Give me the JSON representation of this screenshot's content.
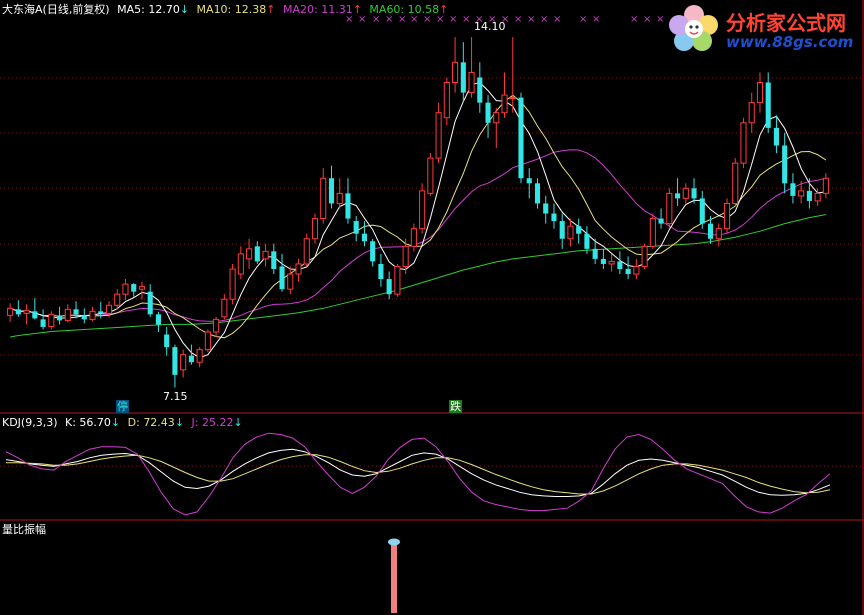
{
  "main_legend": {
    "stock": "大东海A(日线,前复权)",
    "ma5": "MA5: 12.70",
    "ma5_arrow": "↓",
    "ma10": "MA10: 12.38",
    "ma10_arrow": "↑",
    "ma20": "MA20: 11.31",
    "ma20_arrow": "↑",
    "ma60": "MA60: 10.58",
    "ma60_arrow": "↑"
  },
  "annotations": {
    "high_label": "14.10",
    "low_label": "7.15",
    "marker_stop": "停",
    "marker_fall": "跌"
  },
  "kdj_legend": {
    "name": "KDJ(9,3,3)",
    "k": "K: 56.70",
    "k_arrow": "↓",
    "d": "D: 72.43",
    "d_arrow": "↓",
    "j": "J: 25.22",
    "j_arrow": "↓"
  },
  "volume_panel": {
    "name": "量比振幅"
  },
  "logo": {
    "title": "分析家公式网",
    "url": "www.88gs.com"
  },
  "colors": {
    "background": "#000000",
    "up": "#ff3a3a",
    "down": "#34e5e5",
    "ma5": "#ffffff",
    "ma10": "#e8e07a",
    "ma20": "#d23cd2",
    "ma60": "#2fcc2f",
    "k": "#ffffff",
    "d": "#e8e07a",
    "j": "#d23cd2",
    "grid": "#8a1010",
    "volume_bar": "#f08080"
  },
  "chart_data": [
    {
      "type": "candlestick",
      "title": "大东海A(日线,前复权)",
      "ylim": [
        7.0,
        14.4
      ],
      "candles": [
        [
          8.58,
          8.82,
          8.45,
          8.72
        ],
        [
          8.7,
          8.88,
          8.55,
          8.6
        ],
        [
          8.62,
          8.8,
          8.4,
          8.68
        ],
        [
          8.66,
          8.92,
          8.5,
          8.52
        ],
        [
          8.5,
          8.7,
          8.3,
          8.35
        ],
        [
          8.36,
          8.66,
          8.3,
          8.6
        ],
        [
          8.58,
          8.75,
          8.4,
          8.48
        ],
        [
          8.48,
          8.8,
          8.44,
          8.7
        ],
        [
          8.7,
          8.86,
          8.52,
          8.6
        ],
        [
          8.58,
          8.72,
          8.42,
          8.5
        ],
        [
          8.5,
          8.75,
          8.46,
          8.66
        ],
        [
          8.66,
          8.85,
          8.52,
          8.62
        ],
        [
          8.62,
          8.86,
          8.54,
          8.78
        ],
        [
          8.78,
          9.1,
          8.7,
          9.0
        ],
        [
          9.0,
          9.3,
          8.88,
          9.2
        ],
        [
          9.2,
          9.22,
          8.95,
          9.05
        ],
        [
          9.1,
          9.25,
          8.9,
          9.15
        ],
        [
          9.05,
          9.2,
          8.55,
          8.6
        ],
        [
          8.6,
          8.65,
          8.25,
          8.4
        ],
        [
          8.2,
          8.35,
          7.78,
          7.95
        ],
        [
          7.95,
          8.0,
          7.15,
          7.4
        ],
        [
          7.5,
          7.9,
          7.35,
          7.8
        ],
        [
          7.78,
          8.0,
          7.6,
          7.65
        ],
        [
          7.65,
          7.95,
          7.55,
          7.9
        ],
        [
          7.9,
          8.3,
          7.85,
          8.25
        ],
        [
          8.25,
          8.55,
          8.15,
          8.5
        ],
        [
          8.55,
          9.0,
          8.5,
          8.9
        ],
        [
          8.9,
          9.6,
          8.8,
          9.5
        ],
        [
          9.4,
          9.95,
          9.3,
          9.8
        ],
        [
          9.7,
          10.1,
          9.5,
          9.9
        ],
        [
          9.95,
          10.05,
          9.6,
          9.65
        ],
        [
          9.7,
          10.0,
          9.55,
          9.85
        ],
        [
          9.85,
          10.0,
          9.4,
          9.5
        ],
        [
          9.55,
          9.8,
          9.05,
          9.1
        ],
        [
          9.1,
          9.55,
          9.0,
          9.4
        ],
        [
          9.4,
          9.7,
          9.25,
          9.6
        ],
        [
          9.6,
          10.2,
          9.55,
          10.1
        ],
        [
          10.1,
          10.6,
          10.0,
          10.5
        ],
        [
          10.5,
          11.5,
          10.4,
          11.3
        ],
        [
          11.3,
          11.55,
          10.7,
          10.8
        ],
        [
          10.8,
          11.3,
          10.7,
          11.0
        ],
        [
          11.0,
          11.3,
          10.4,
          10.5
        ],
        [
          10.45,
          10.55,
          10.05,
          10.2
        ],
        [
          10.2,
          10.45,
          9.95,
          10.05
        ],
        [
          10.05,
          10.1,
          9.55,
          9.65
        ],
        [
          9.6,
          9.8,
          9.15,
          9.3
        ],
        [
          9.3,
          9.45,
          8.9,
          9.0
        ],
        [
          9.0,
          9.6,
          8.95,
          9.55
        ],
        [
          9.55,
          10.1,
          9.4,
          9.95
        ],
        [
          9.95,
          10.4,
          9.85,
          10.3
        ],
        [
          10.3,
          11.2,
          10.2,
          11.05
        ],
        [
          11.0,
          11.8,
          10.95,
          11.7
        ],
        [
          11.7,
          12.8,
          11.6,
          12.6
        ],
        [
          12.5,
          13.3,
          12.35,
          13.2
        ],
        [
          13.2,
          14.1,
          13.0,
          13.6
        ],
        [
          13.6,
          14.0,
          12.8,
          13.0
        ],
        [
          13.0,
          14.1,
          12.9,
          13.4
        ],
        [
          13.3,
          13.6,
          12.6,
          12.8
        ],
        [
          12.8,
          12.95,
          12.1,
          12.4
        ],
        [
          12.4,
          12.7,
          11.9,
          12.6
        ],
        [
          12.6,
          13.4,
          12.5,
          12.95
        ],
        [
          12.9,
          14.1,
          12.6,
          12.9
        ],
        [
          12.9,
          13.0,
          11.2,
          11.3
        ],
        [
          11.3,
          11.5,
          10.9,
          11.2
        ],
        [
          11.2,
          11.3,
          10.7,
          10.8
        ],
        [
          10.8,
          10.95,
          10.4,
          10.6
        ],
        [
          10.6,
          10.8,
          10.3,
          10.45
        ],
        [
          10.45,
          10.6,
          9.9,
          10.1
        ],
        [
          10.1,
          10.5,
          9.95,
          10.35
        ],
        [
          10.35,
          10.5,
          10.0,
          10.2
        ],
        [
          10.2,
          10.35,
          9.8,
          9.9
        ],
        [
          9.9,
          10.1,
          9.6,
          9.7
        ],
        [
          9.7,
          9.9,
          9.5,
          9.6
        ],
        [
          9.6,
          9.8,
          9.45,
          9.65
        ],
        [
          9.65,
          9.85,
          9.4,
          9.5
        ],
        [
          9.5,
          9.75,
          9.3,
          9.4
        ],
        [
          9.4,
          9.7,
          9.3,
          9.55
        ],
        [
          9.55,
          10.0,
          9.5,
          9.95
        ],
        [
          9.95,
          10.6,
          9.9,
          10.5
        ],
        [
          10.5,
          10.7,
          10.3,
          10.4
        ],
        [
          10.4,
          11.1,
          10.3,
          11.0
        ],
        [
          11.0,
          11.3,
          10.75,
          10.9
        ],
        [
          10.9,
          11.2,
          10.8,
          11.1
        ],
        [
          11.1,
          11.3,
          10.8,
          10.9
        ],
        [
          10.9,
          11.05,
          10.3,
          10.4
        ],
        [
          10.4,
          10.55,
          10.0,
          10.1
        ],
        [
          10.1,
          10.4,
          9.95,
          10.3
        ],
        [
          10.3,
          10.9,
          10.2,
          10.8
        ],
        [
          10.8,
          11.7,
          10.75,
          11.6
        ],
        [
          11.6,
          12.5,
          11.5,
          12.4
        ],
        [
          12.4,
          13.0,
          12.2,
          12.8
        ],
        [
          12.8,
          13.4,
          12.6,
          13.2
        ],
        [
          13.2,
          13.4,
          12.2,
          12.3
        ],
        [
          12.3,
          12.55,
          11.8,
          11.95
        ],
        [
          11.95,
          12.2,
          11.0,
          11.2
        ],
        [
          11.2,
          11.4,
          10.8,
          10.95
        ],
        [
          10.95,
          11.25,
          10.8,
          11.05
        ],
        [
          11.05,
          11.3,
          10.7,
          10.85
        ],
        [
          10.85,
          11.1,
          10.75,
          11.0
        ],
        [
          11.0,
          11.4,
          10.9,
          11.3
        ]
      ],
      "ma60_approx": [
        8.15,
        8.18,
        8.2,
        8.22,
        8.24,
        8.26,
        8.27,
        8.28,
        8.29,
        8.3,
        8.31,
        8.32,
        8.33,
        8.34,
        8.35,
        8.36,
        8.37,
        8.38,
        8.39,
        8.4,
        8.4,
        8.4,
        8.4,
        8.41,
        8.42,
        8.43,
        8.45,
        8.47,
        8.49,
        8.51,
        8.53,
        8.55,
        8.57,
        8.59,
        8.61,
        8.63,
        8.66,
        8.69,
        8.72,
        8.76,
        8.8,
        8.84,
        8.88,
        8.92,
        8.96,
        9.0,
        9.04,
        9.08,
        9.13,
        9.18,
        9.23,
        9.28,
        9.33,
        9.38,
        9.43,
        9.48,
        9.52,
        9.56,
        9.6,
        9.64,
        9.67,
        9.7,
        9.72,
        9.74,
        9.76,
        9.78,
        9.8,
        9.82,
        9.84,
        9.86,
        9.87,
        9.88,
        9.89,
        9.9,
        9.91,
        9.92,
        9.93,
        9.94,
        9.95,
        9.96,
        9.97,
        9.98,
        9.99,
        10.0,
        10.02,
        10.04,
        10.07,
        10.1,
        10.13,
        10.17,
        10.21,
        10.25,
        10.3,
        10.35,
        10.4,
        10.44,
        10.48,
        10.52,
        10.55,
        10.58
      ]
    },
    {
      "type": "line",
      "title": "KDJ(9,3,3)",
      "ylim": [
        -20,
        120
      ],
      "series": [
        {
          "name": "K",
          "values": [
            75,
            72,
            68,
            66,
            64,
            68,
            72,
            78,
            82,
            84,
            85,
            82,
            70,
            55,
            40,
            30,
            28,
            32,
            42,
            56,
            68,
            78,
            86,
            90,
            92,
            88,
            80,
            70,
            58,
            50,
            48,
            52,
            62,
            72,
            82,
            86,
            84,
            76,
            64,
            52,
            42,
            34,
            28,
            22,
            18,
            16,
            15,
            15,
            16,
            20,
            35,
            52,
            66,
            74,
            76,
            74,
            70,
            66,
            62,
            56,
            50,
            40,
            30,
            22,
            18,
            17,
            18,
            20,
            26,
            34
          ]
        },
        {
          "name": "D",
          "values": [
            70,
            70,
            69,
            68,
            66,
            66,
            68,
            72,
            76,
            79,
            81,
            82,
            78,
            72,
            63,
            54,
            46,
            40,
            40,
            44,
            52,
            60,
            68,
            75,
            80,
            83,
            83,
            79,
            72,
            64,
            57,
            54,
            56,
            61,
            68,
            74,
            78,
            78,
            74,
            67,
            59,
            51,
            44,
            37,
            31,
            26,
            23,
            21,
            19,
            19,
            24,
            32,
            42,
            52,
            60,
            66,
            68,
            68,
            66,
            62,
            58,
            52,
            46,
            38,
            32,
            27,
            23,
            21,
            22,
            26
          ]
        },
        {
          "name": "J",
          "values": [
            88,
            78,
            66,
            60,
            58,
            72,
            82,
            92,
            96,
            96,
            95,
            84,
            55,
            22,
            -5,
            -15,
            -10,
            15,
            45,
            78,
            100,
            112,
            118,
            116,
            110,
            96,
            72,
            50,
            30,
            20,
            30,
            48,
            75,
            95,
            108,
            110,
            96,
            72,
            44,
            22,
            8,
            2,
            -2,
            -6,
            -8,
            -8,
            -6,
            -4,
            8,
            24,
            60,
            92,
            112,
            116,
            108,
            92,
            74,
            60,
            52,
            44,
            36,
            16,
            -2,
            -10,
            -12,
            -4,
            8,
            18,
            36,
            52
          ]
        }
      ]
    },
    {
      "type": "bar",
      "title": "量比振幅",
      "values": [
        1
      ]
    }
  ]
}
